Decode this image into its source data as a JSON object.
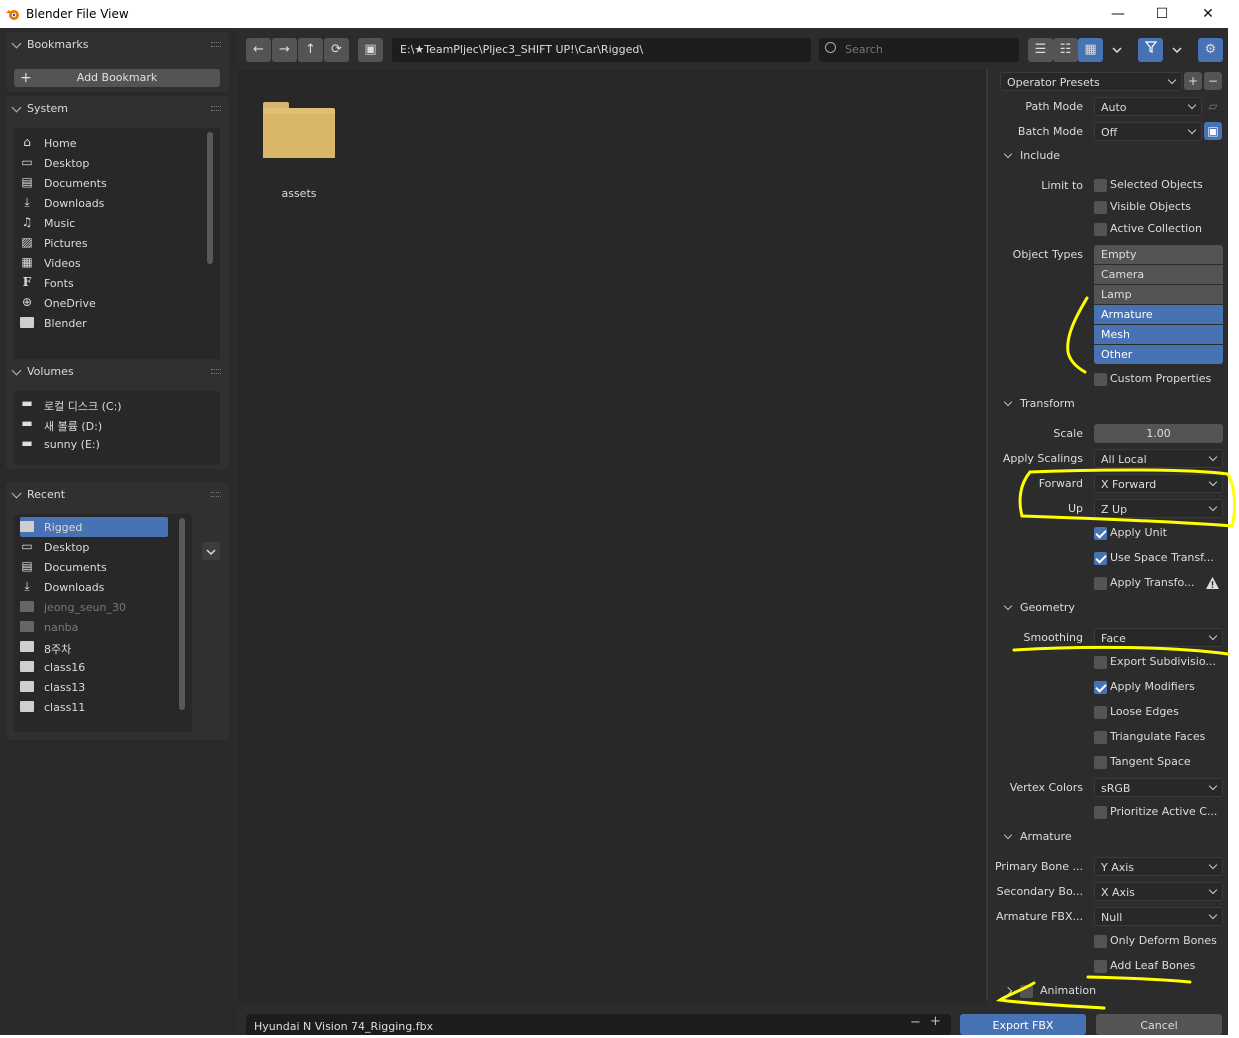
{
  "window": {
    "title": "Blender File View",
    "min": "—",
    "max": "☐",
    "close": "✕"
  },
  "sidebar": {
    "bookmarks": {
      "title": "Bookmarks",
      "add_label": "Add Bookmark"
    },
    "system": {
      "title": "System",
      "items": [
        {
          "label": "Home",
          "icon": "home-icon"
        },
        {
          "label": "Desktop",
          "icon": "desktop-icon"
        },
        {
          "label": "Documents",
          "icon": "documents-icon"
        },
        {
          "label": "Downloads",
          "icon": "downloads-icon"
        },
        {
          "label": "Music",
          "icon": "music-icon"
        },
        {
          "label": "Pictures",
          "icon": "pictures-icon"
        },
        {
          "label": "Videos",
          "icon": "videos-icon"
        },
        {
          "label": "Fonts",
          "icon": "fonts-icon"
        },
        {
          "label": "OneDrive",
          "icon": "globe-icon"
        },
        {
          "label": "Blender",
          "icon": "folder-icon"
        }
      ]
    },
    "volumes": {
      "title": "Volumes",
      "items": [
        "로컬 디스크 (C:)",
        "새 볼륨 (D:)",
        "sunny (E:)"
      ]
    },
    "recent": {
      "title": "Recent",
      "items": [
        "Rigged",
        "Desktop",
        "Documents",
        "Downloads",
        "jeong_seun_30",
        "nanba",
        "8주차",
        "class16",
        "class13",
        "class11"
      ]
    }
  },
  "toolbar": {
    "path": "E:\\★TeamPljec\\Pljec3_SHIFT UP!\\Car\\Rigged\\",
    "search_placeholder": "Search"
  },
  "files": [
    {
      "name": "assets"
    }
  ],
  "bottom": {
    "filename": "Hyundai N Vision 74_Rigging.fbx",
    "minus": "−",
    "plus": "+",
    "export_label": "Export FBX",
    "cancel_label": "Cancel"
  },
  "props": {
    "operator_presets": "Operator Presets",
    "path_mode": {
      "label": "Path Mode",
      "value": "Auto"
    },
    "batch_mode": {
      "label": "Batch Mode",
      "value": "Off"
    },
    "include": {
      "title": "Include",
      "limit_to": "Limit to",
      "selected_objects": "Selected Objects",
      "visible_objects": "Visible Objects",
      "active_collection": "Active Collection",
      "object_types": "Object Types",
      "types": [
        {
          "label": "Empty",
          "on": false
        },
        {
          "label": "Camera",
          "on": false
        },
        {
          "label": "Lamp",
          "on": false
        },
        {
          "label": "Armature",
          "on": true
        },
        {
          "label": "Mesh",
          "on": true
        },
        {
          "label": "Other",
          "on": true
        }
      ],
      "custom_properties": "Custom Properties"
    },
    "transform": {
      "title": "Transform",
      "scale_label": "Scale",
      "scale_value": "1.00",
      "apply_scalings_label": "Apply Scalings",
      "apply_scalings": "All Local",
      "forward_label": "Forward",
      "forward": "X Forward",
      "up_label": "Up",
      "up": "Z Up",
      "apply_unit": "Apply Unit",
      "use_space_transform": "Use Space Transf...",
      "apply_transform": "Apply Transfo..."
    },
    "geometry": {
      "title": "Geometry",
      "smoothing_label": "Smoothing",
      "smoothing": "Face",
      "export_subdivision": "Export Subdivisio...",
      "apply_modifiers": "Apply Modifiers",
      "loose_edges": "Loose Edges",
      "triangulate_faces": "Triangulate Faces",
      "tangent_space": "Tangent Space",
      "vertex_colors_label": "Vertex Colors",
      "vertex_colors": "sRGB",
      "prioritize_active": "Prioritize Active C..."
    },
    "armature": {
      "title": "Armature",
      "primary_label": "Primary Bone ...",
      "primary": "Y Axis",
      "secondary_label": "Secondary Bo...",
      "secondary": "X Axis",
      "node_type_label": "Armature FBX...",
      "node_type": "Null",
      "only_deform": "Only Deform Bones",
      "add_leaf": "Add Leaf Bones"
    },
    "animation": {
      "title": "Animation"
    }
  },
  "colors": {
    "accent": "#4772b3",
    "annotation": "#ffff00"
  }
}
